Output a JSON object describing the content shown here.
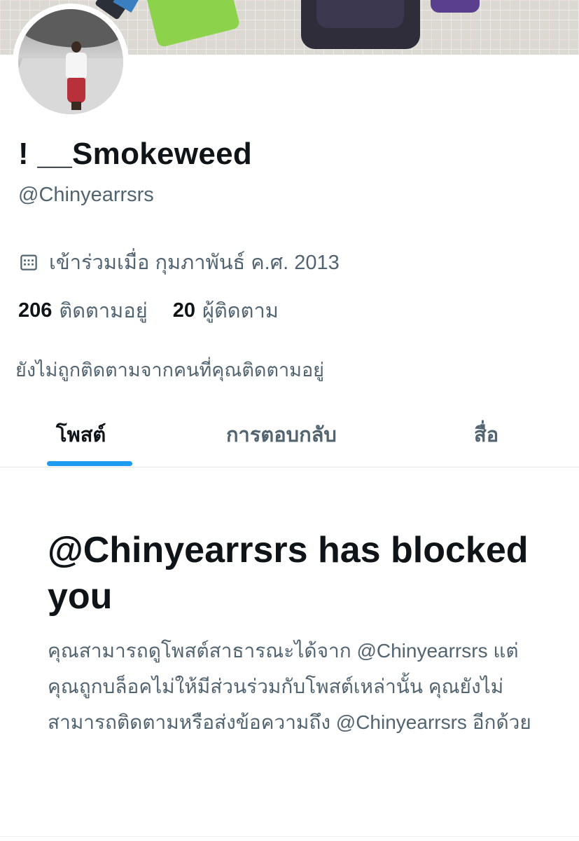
{
  "profile": {
    "display_name": "! __Smokeweed",
    "handle": "@Chinyearrsrs",
    "joined": "เข้าร่วมเมื่อ กุมภาพันธ์ ค.ศ. 2013",
    "following_count": "206",
    "following_label": "ติดตามอยู่",
    "followers_count": "20",
    "followers_label": "ผู้ติดตาม",
    "not_followed_note": "ยังไม่ถูกติดตามจากคนที่คุณติดตามอยู่"
  },
  "icons": {
    "joined": "calendar-icon"
  },
  "tabs": [
    {
      "label": "โพสต์",
      "active": true
    },
    {
      "label": "การตอบกลับ",
      "active": false
    },
    {
      "label": "สื่อ",
      "active": false
    }
  ],
  "blocked": {
    "title": "@Chinyearrsrs has blocked you",
    "description": "คุณสามารถดูโพสต์สาธารณะได้จาก @Chinyearrsrs แต่คุณถูกบล็อคไม่ให้มีส่วนร่วมกับโพสต์เหล่านั้น คุณยังไม่สามารถติดตามหรือส่งข้อความถึง @Chinyearrsrs อีกด้วย"
  },
  "colors": {
    "accent": "#1d9bf0",
    "primary_text": "#0f1419",
    "secondary_text": "#536471",
    "divider": "#e3e6e8"
  }
}
